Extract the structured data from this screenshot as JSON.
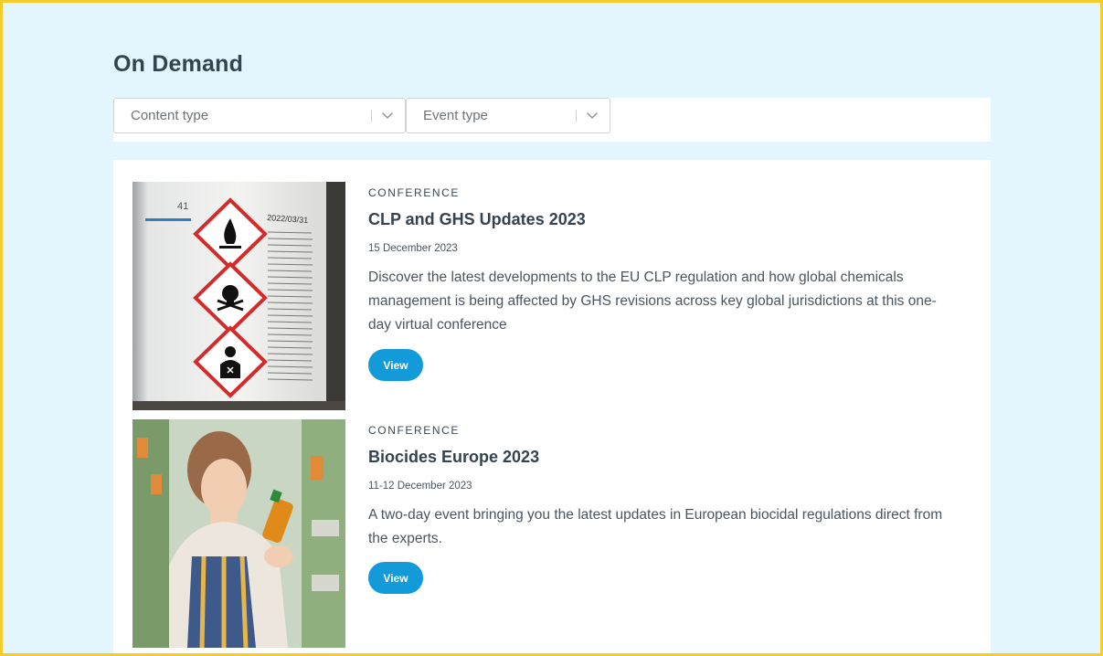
{
  "page": {
    "title": "On Demand"
  },
  "filters": {
    "content_type": {
      "placeholder": "Content type"
    },
    "event_type": {
      "placeholder": "Event type"
    }
  },
  "events": [
    {
      "category": "CONFERENCE",
      "title": "CLP and GHS Updates 2023",
      "date": "15 December 2023",
      "description": "Discover the latest developments to the EU CLP regulation and how global chemicals management is being affected by GHS revisions across key global jurisdictions at this one-day virtual conference",
      "button_label": "View",
      "image_label_number": "41",
      "image_label_date": "2022/03/31"
    },
    {
      "category": "CONFERENCE",
      "title": "Biocides Europe 2023",
      "date": "11-12 December 2023",
      "description": "A two-day event bringing you the latest updates in European biocidal regulations direct from the experts.",
      "button_label": "View"
    }
  ],
  "colors": {
    "page_background": "#e3f6fd",
    "frame_border": "#f5cd2a",
    "button_primary": "#139ad8",
    "hazard_red": "#d42a2a"
  }
}
